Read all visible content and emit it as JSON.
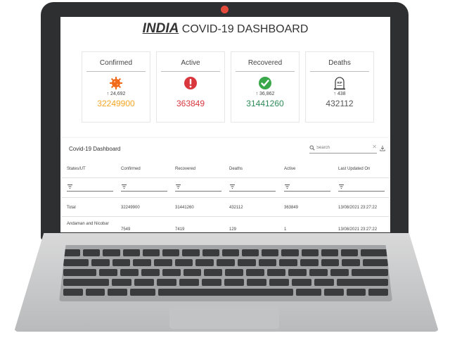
{
  "dashboard": {
    "title_brand": "INDIA",
    "title_rest": " COVID-19 DASHBOARD",
    "cards": [
      {
        "label": "Confirmed",
        "icon": "virus-icon",
        "delta": "24,692",
        "value": "32249900",
        "color": "#f5a623"
      },
      {
        "label": "Active",
        "icon": "alert-icon",
        "delta": "",
        "value": "363849",
        "color": "#d9363e"
      },
      {
        "label": "Recovered",
        "icon": "check-icon",
        "delta": "36,862",
        "value": "31441260",
        "color": "#2e8b57"
      },
      {
        "label": "Deaths",
        "icon": "tombstone-icon",
        "delta": "438",
        "value": "432112",
        "color": "#555555"
      }
    ],
    "delta_arrow": "↑",
    "tombstone_text": "RIP"
  },
  "table": {
    "title": "Covid-19 Dashboard",
    "search_placeholder": "Search",
    "columns": [
      "States/UT",
      "Confirmed",
      "Recovered",
      "Deaths",
      "Active",
      "Last Updated On"
    ],
    "rows": [
      [
        "Total",
        "32249900",
        "31441260",
        "432112",
        "363849",
        "13/08/2021 23:27:22"
      ],
      [
        "Andaman and Nicobar",
        "7549",
        "7419",
        "129",
        "1",
        "13/08/2021 23:27:22"
      ]
    ]
  }
}
